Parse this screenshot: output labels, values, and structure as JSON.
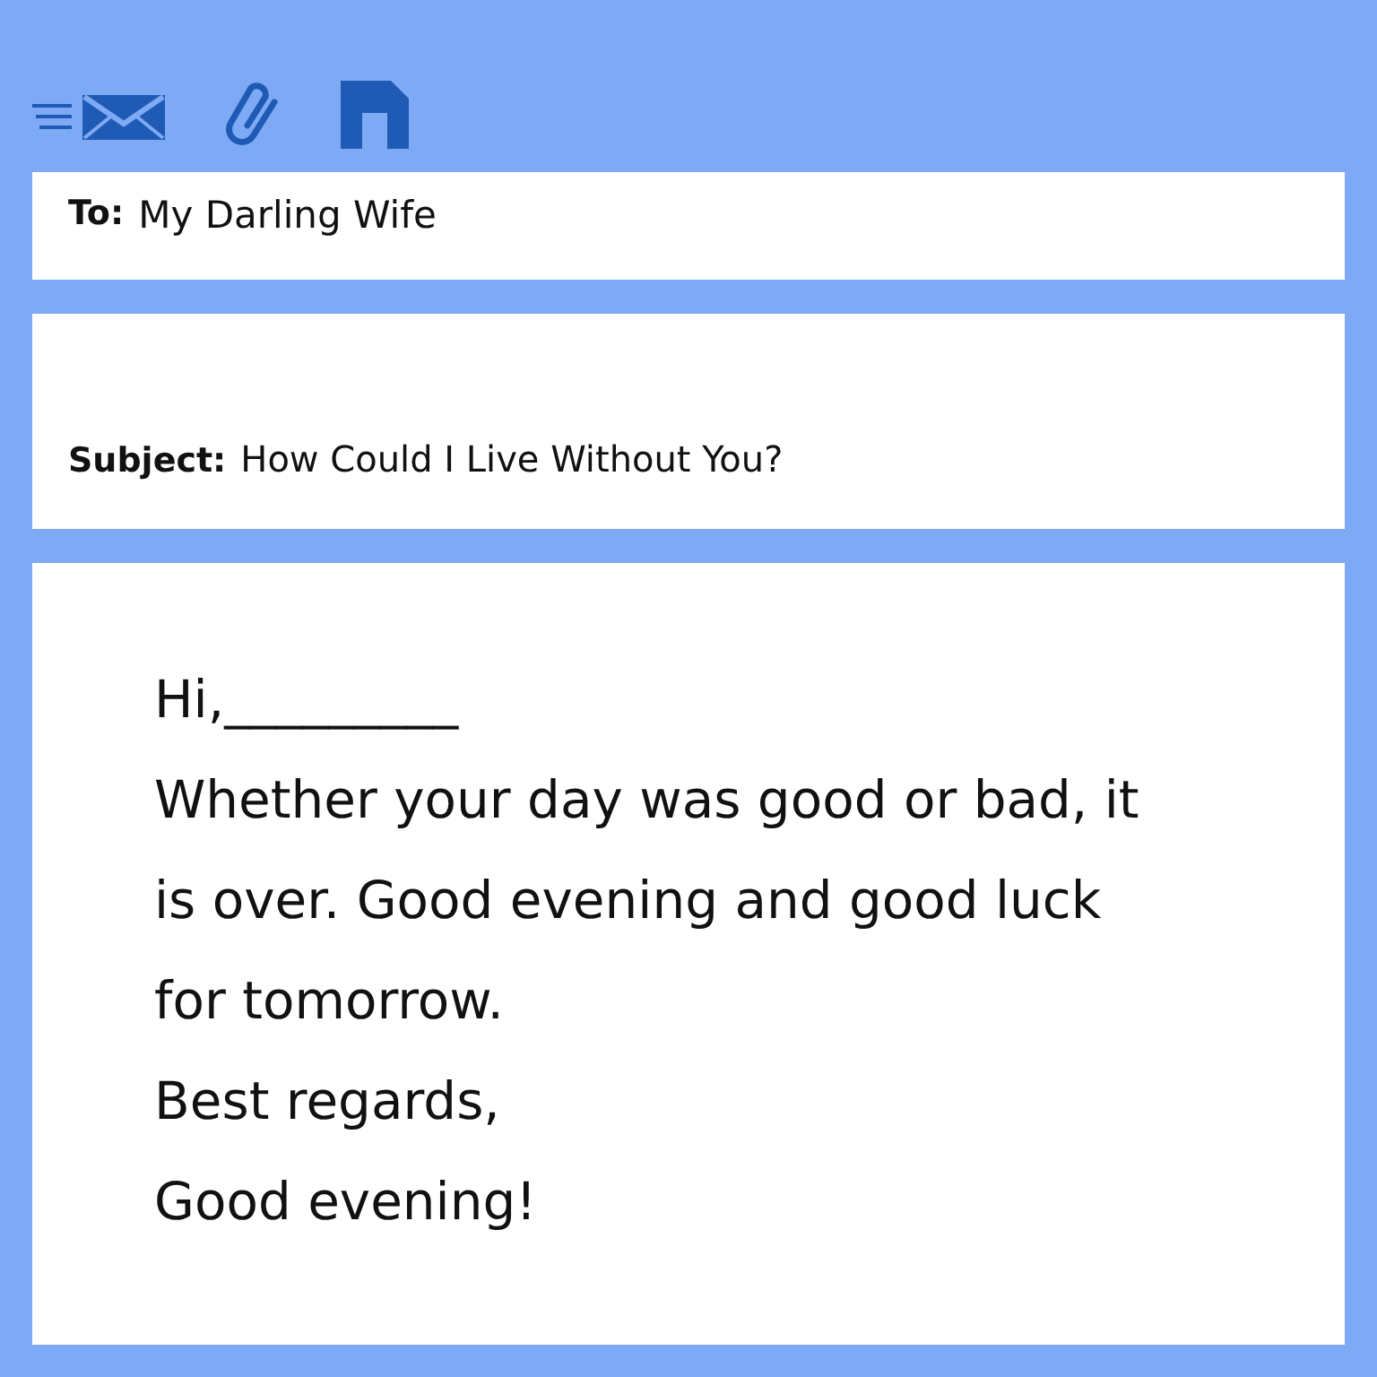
{
  "to": {
    "label": "To:",
    "value": "My Darling Wife"
  },
  "subject": {
    "label": "Subject:",
    "value": "How Could I Live Without You?"
  },
  "body": [
    "Hi,_________",
    "Whether your day was good or bad, it is over. Good evening and good luck for tomorrow.",
    "Best regards,",
    "Good evening!"
  ]
}
